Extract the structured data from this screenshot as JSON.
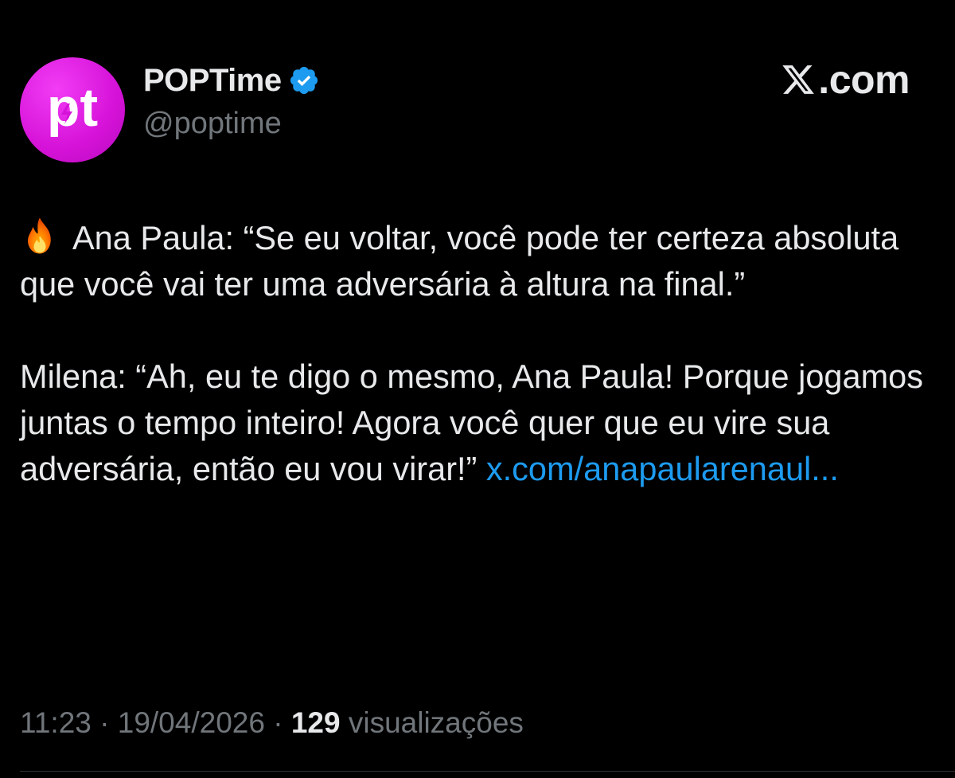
{
  "author": {
    "display_name": "POPTime",
    "handle": "@poptime",
    "avatar_text": "pt",
    "verified": true,
    "avatar_color": "#d512d8"
  },
  "brand": {
    "label": ".com",
    "icon": "x-logo-icon"
  },
  "tweet": {
    "paragraph1_text": "Ana Paula: “Se eu voltar, você pode ter certeza absoluta que você vai ter uma adversária à altura na final.”",
    "paragraph1_icon": "fire-emoji-icon",
    "paragraph2_text": "Milena: “Ah, eu te digo o mesmo, Ana Paula! Porque jogamos juntas o tempo inteiro! Agora você quer que eu vire sua adversária, então eu vou virar!”",
    "link_text": "x.com/anapaularenaul..."
  },
  "meta": {
    "time": "11:23",
    "separator": "·",
    "date": "19/04/2026",
    "views_count": "129",
    "views_label": "visualizações"
  },
  "colors": {
    "background": "#000000",
    "text": "#e7e9ea",
    "secondary_text": "#71767b",
    "link": "#1d9bf0",
    "verified_badge": "#1d9bf0"
  }
}
